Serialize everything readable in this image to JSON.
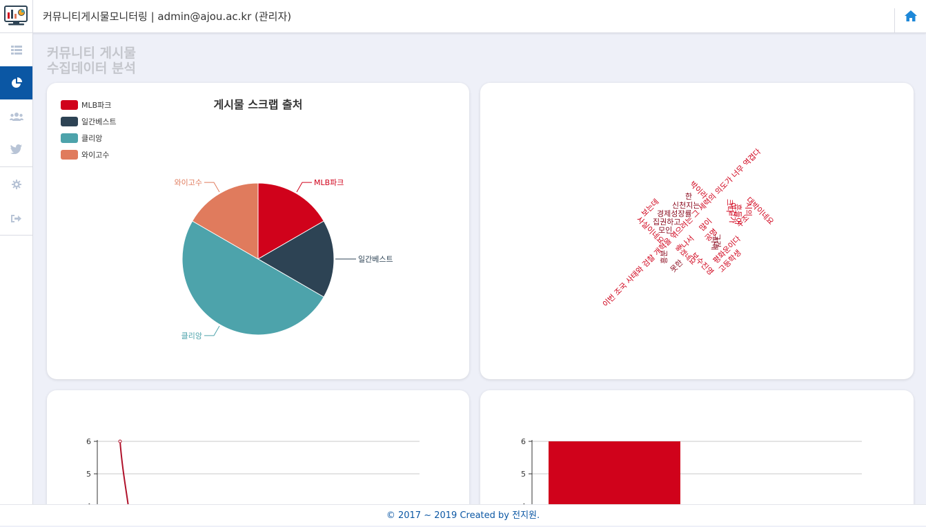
{
  "header": {
    "title": "커뮤니티게시물모니터링 | admin@ajou.ac.kr (관리자)",
    "logo_icon": "monitor-chart-icon",
    "home_icon": "home-icon"
  },
  "sidebar": {
    "items": [
      {
        "icon": "list-icon",
        "active": false
      },
      {
        "icon": "pie-chart-icon",
        "active": true
      },
      {
        "icon": "users-icon",
        "active": false
      },
      {
        "icon": "twitter-icon",
        "active": false
      },
      {
        "icon": "gear-icon",
        "active": false
      },
      {
        "icon": "sign-out-icon",
        "active": false
      }
    ]
  },
  "page": {
    "title_line1": "커뮤니티 게시물",
    "title_line2": "수집데이터 분석"
  },
  "colors": {
    "accent": "#0b57a4",
    "red": "#d0021b",
    "navy": "#2d4354",
    "teal": "#4da3ab",
    "orange": "#e07b5d"
  },
  "chart_data": [
    {
      "type": "pie",
      "title": "게시물 스크랩 출처",
      "legend_position": "top-left",
      "categories": [
        "MLB파크",
        "일간베스트",
        "클리앙",
        "와이고수"
      ],
      "values": [
        1,
        1,
        3,
        1
      ],
      "colors": [
        "#d0021b",
        "#2d4354",
        "#4da3ab",
        "#e07b5d"
      ]
    },
    {
      "type": "line",
      "ylim": [
        4,
        6
      ],
      "yticks": [
        "6",
        "5",
        "4"
      ],
      "series": [
        {
          "values": [
            6,
            4
          ]
        }
      ],
      "grid": true
    },
    {
      "type": "bar",
      "ylim": [
        4,
        6
      ],
      "yticks": [
        "6",
        "5",
        "4"
      ],
      "series": [
        {
          "values": [
            6
          ]
        }
      ],
      "grid": true
    }
  ],
  "wordcloud": {
    "words": [
      "이번 조국 사태와 검찰 개혁을 엮으려는 그 세력의 의도가 너무 역겹다",
      "사실이네요",
      "보는데",
      "모인",
      "집권하고",
      "경제성장률",
      "신천지는",
      "한",
      "박이라",
      "이걸가",
      "시의",
      "대박이네요",
      "크다",
      "흔들어",
      "많이",
      "나서",
      "그건",
      "못한",
      "수조",
      "보수진영",
      "흥분",
      "공명",
      "좋겠네요",
      "피해",
      "평화운이다",
      "고등학생"
    ]
  },
  "footer": {
    "text": "© 2017 ~ 2019 Created by 전지원."
  }
}
